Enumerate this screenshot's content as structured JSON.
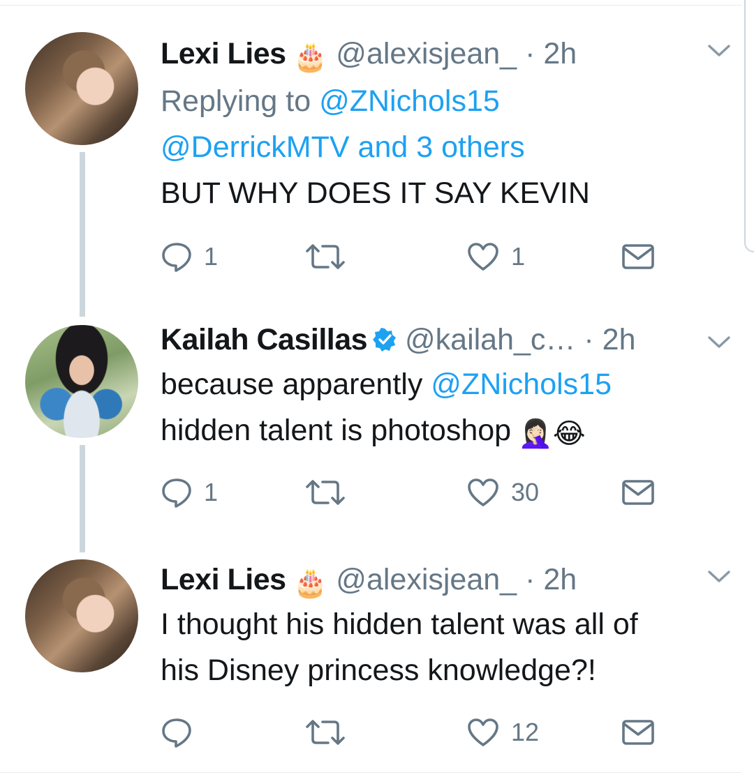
{
  "colors": {
    "link": "#1da1f2",
    "muted": "#657786",
    "text": "#14171a",
    "thread_line": "#ccd6dd"
  },
  "tweets": [
    {
      "name": "Lexi Lies",
      "name_emoji": "🎂",
      "handle": "@alexisjean_",
      "dot": "·",
      "time": "2h",
      "reply_prefix": "Replying to ",
      "reply_to_1": "@ZNichols15",
      "reply_to_2": "@DerrickMTV",
      "reply_others": " and 3 others",
      "text": "BUT WHY DOES IT SAY KEVIN",
      "replies": "1",
      "likes": "1"
    },
    {
      "name": "Kailah Casillas",
      "handle": "@kailah_c…",
      "dot": "·",
      "time": "2h",
      "text_1": "because apparently ",
      "mention": "@ZNichols15",
      "text_2": "hidden talent is photoshop",
      "text_emojis": "🤦🏻‍♀️😂",
      "replies": "1",
      "likes": "30"
    },
    {
      "name": "Lexi Lies",
      "name_emoji": "🎂",
      "handle": "@alexisjean_",
      "dot": "·",
      "time": "2h",
      "text_1": "I thought his hidden talent was all of",
      "text_2": "his Disney princess knowledge?!",
      "replies": "",
      "likes": "12"
    }
  ],
  "icons": [
    "reply-icon",
    "retweet-icon",
    "like-icon",
    "direct-message-icon",
    "chevron-down-icon",
    "verified-badge-icon",
    "birthday-cake-icon"
  ]
}
